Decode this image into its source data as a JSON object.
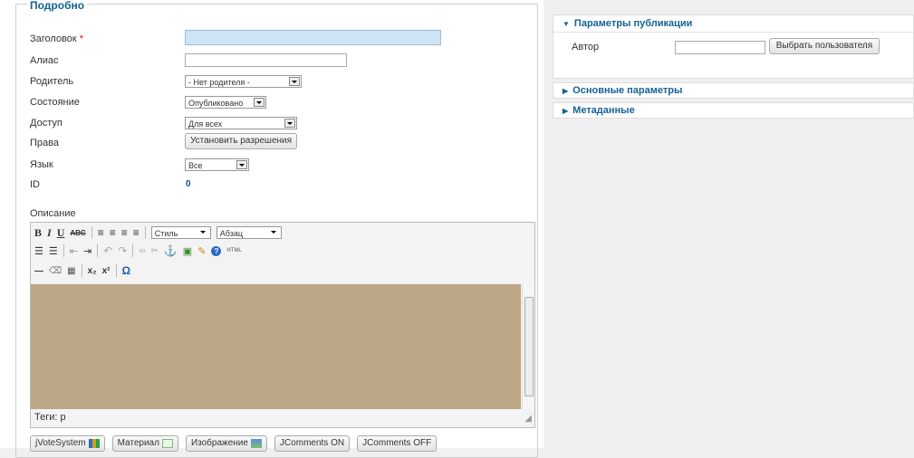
{
  "legend": "Подробно",
  "fields": {
    "title_label": "Заголовок",
    "alias_label": "Алиас",
    "parent_label": "Родитель",
    "parent_value": "- Нет родителя -",
    "state_label": "Состояние",
    "state_value": "Опубликовано",
    "access_label": "Доступ",
    "access_value": "Для всех",
    "rights_label": "Права",
    "rights_button": "Установить разрешения",
    "language_label": "Язык",
    "language_value": "Все",
    "id_label": "ID",
    "id_value": "0",
    "description_label": "Описание"
  },
  "editor": {
    "style_value": "Стиль",
    "format_value": "Абзац",
    "status_path": "Теги: p",
    "area_color": "#bba686"
  },
  "extension_buttons": {
    "vote": "jVoteSystem",
    "article": "Материал",
    "image": "Изображение",
    "jcomments_on": "JComments ON",
    "jcomments_off": "JComments OFF"
  },
  "right": {
    "publish_title": "Параметры публикации",
    "author_label": "Автор",
    "select_user_button": "Выбрать пользователя",
    "basic_title": "Основные параметры",
    "meta_title": "Метаданные"
  },
  "colors": {
    "accent": "#146295",
    "required": "#e00000",
    "title_input_bg": "#cde4f5"
  }
}
